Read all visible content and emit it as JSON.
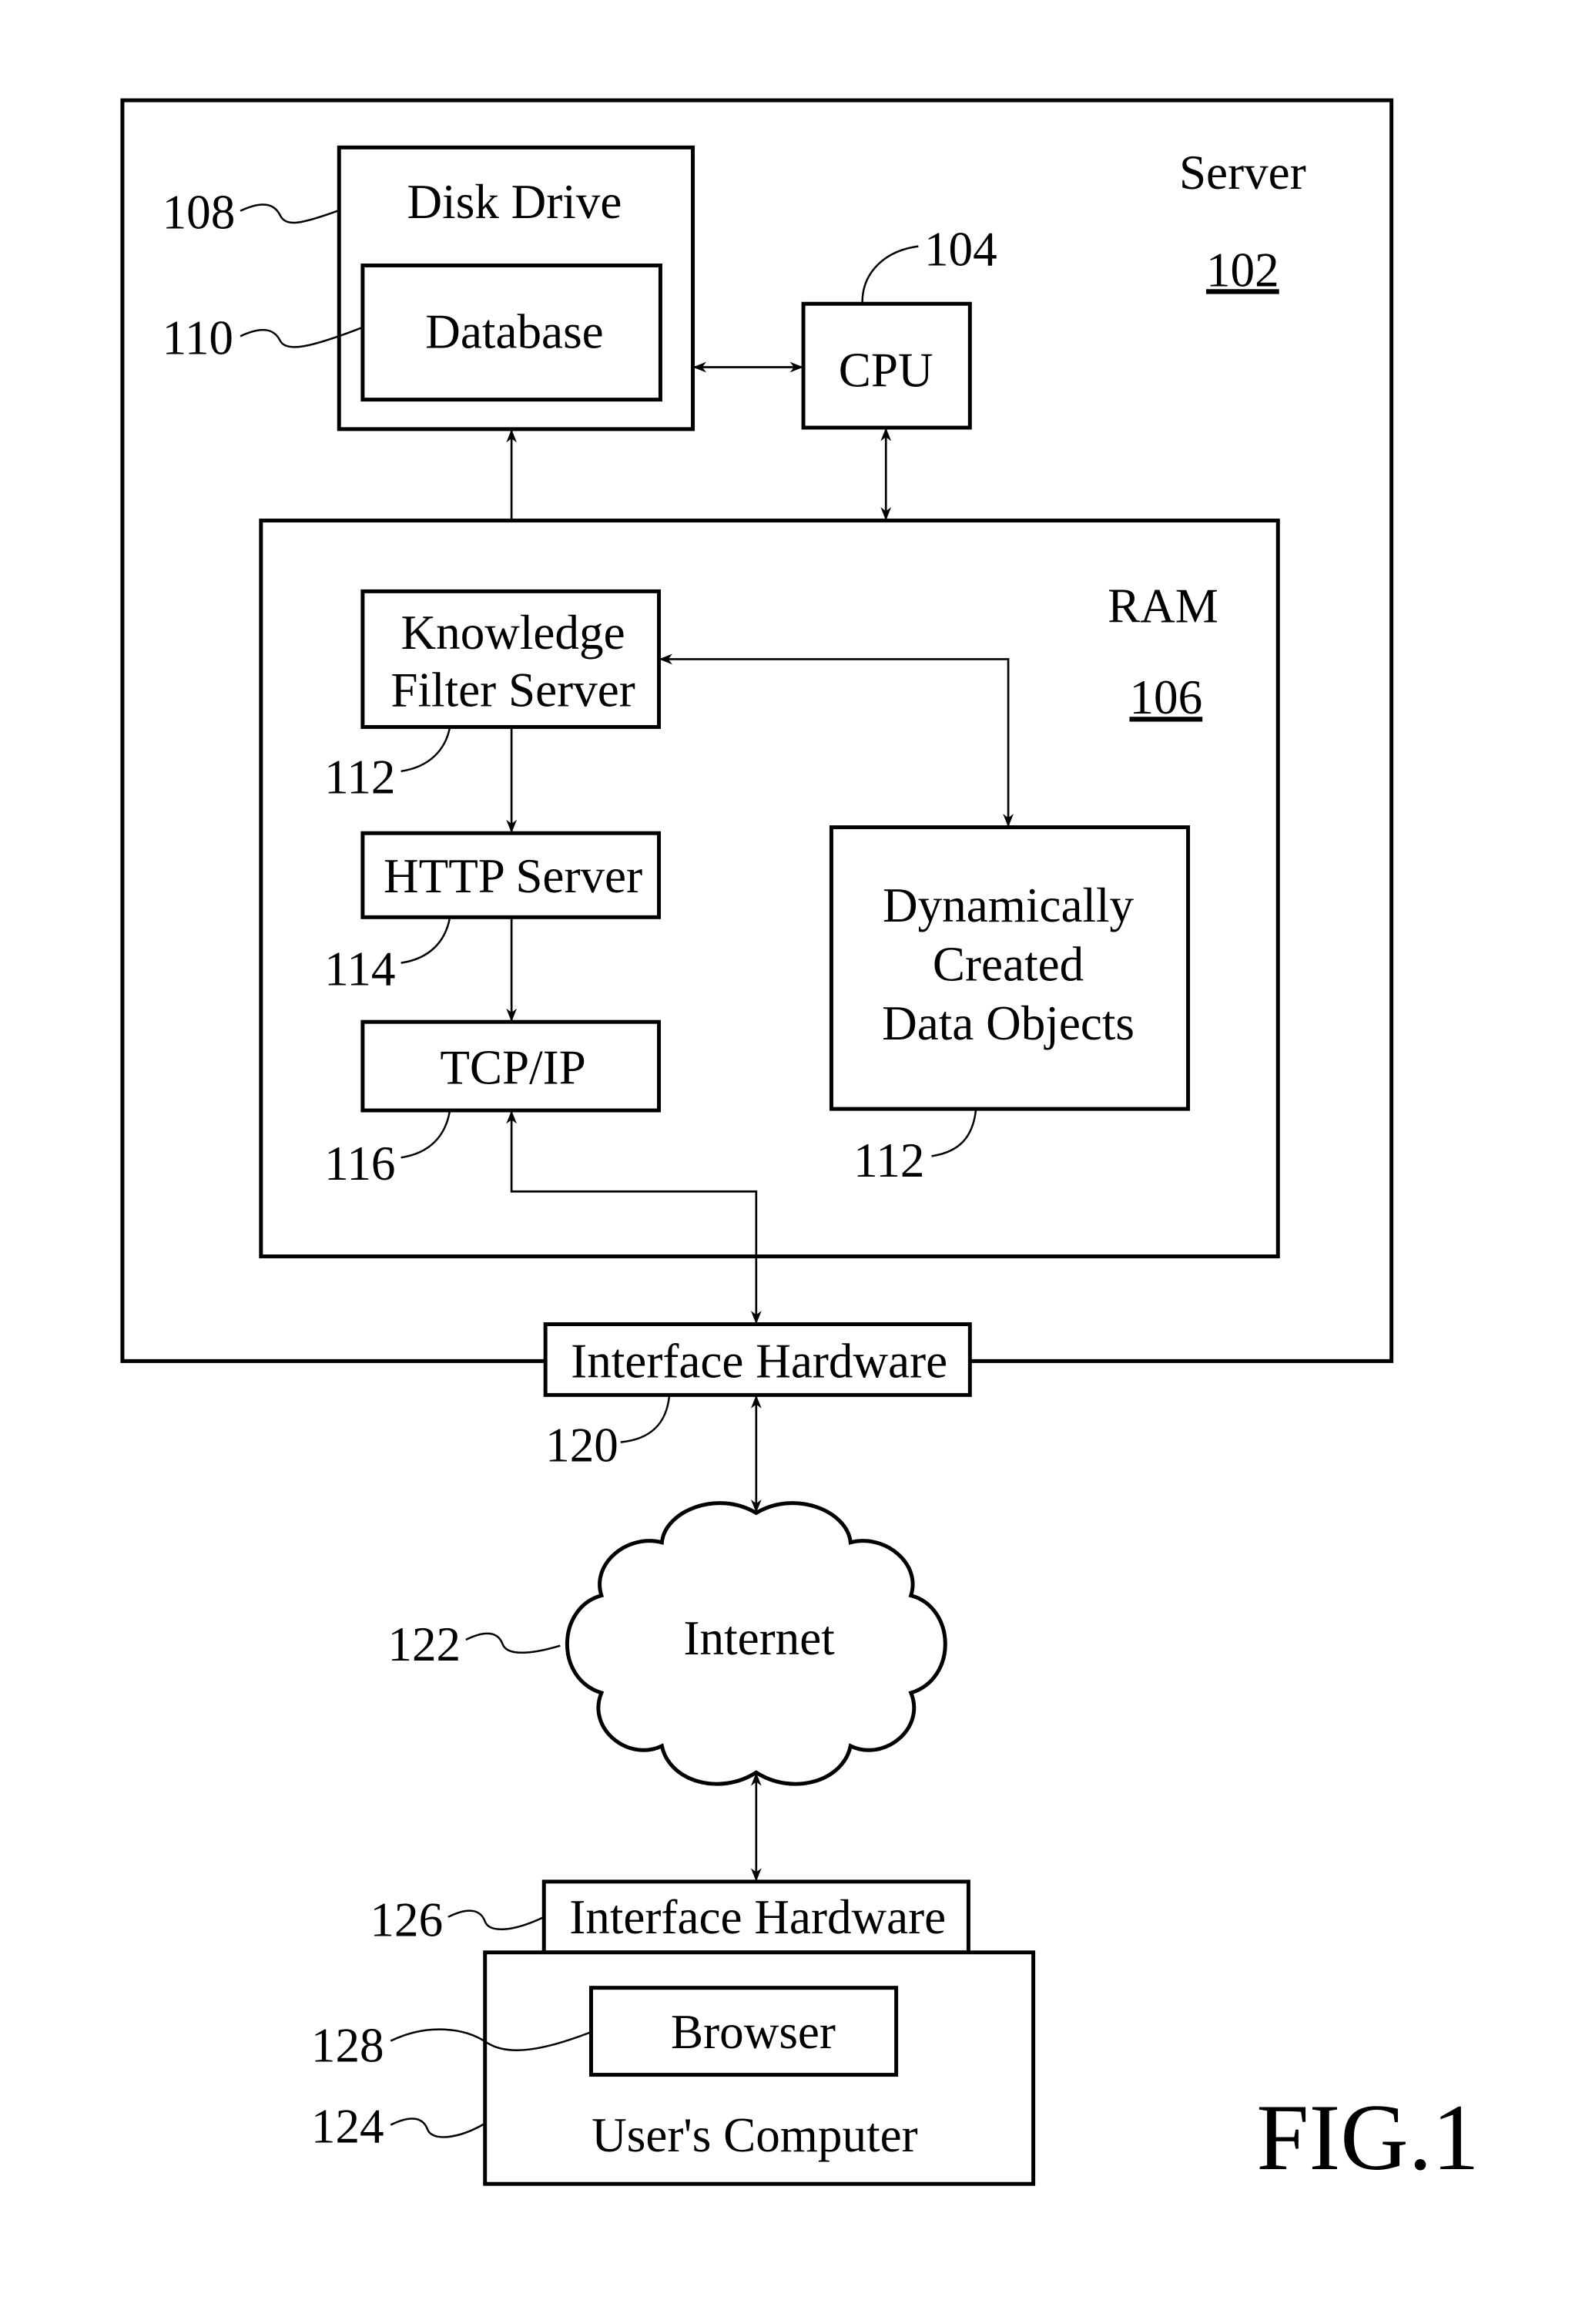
{
  "figure_label": "FIG.1",
  "server": {
    "title": "Server",
    "ref": "102"
  },
  "disk_drive": {
    "title": "Disk Drive",
    "ref": "108"
  },
  "database": {
    "title": "Database",
    "ref": "110"
  },
  "cpu": {
    "title": "CPU",
    "ref": "104"
  },
  "ram": {
    "title": "RAM",
    "ref": "106"
  },
  "knowledge_filter_server": {
    "line1": "Knowledge",
    "line2": "Filter Server",
    "ref": "112"
  },
  "http_server": {
    "title": "HTTP Server",
    "ref": "114"
  },
  "tcp_ip": {
    "title": "TCP/IP",
    "ref": "116"
  },
  "dynamic_objects": {
    "line1": "Dynamically",
    "line2": "Created",
    "line3": "Data Objects",
    "ref": "112"
  },
  "server_interface": {
    "title": "Interface Hardware",
    "ref": "120"
  },
  "internet": {
    "title": "Internet",
    "ref": "122"
  },
  "client_interface": {
    "title": "Interface Hardware",
    "ref": "126"
  },
  "users_computer": {
    "title": "User's Computer",
    "ref": "124"
  },
  "browser": {
    "title": "Browser",
    "ref": "128"
  }
}
